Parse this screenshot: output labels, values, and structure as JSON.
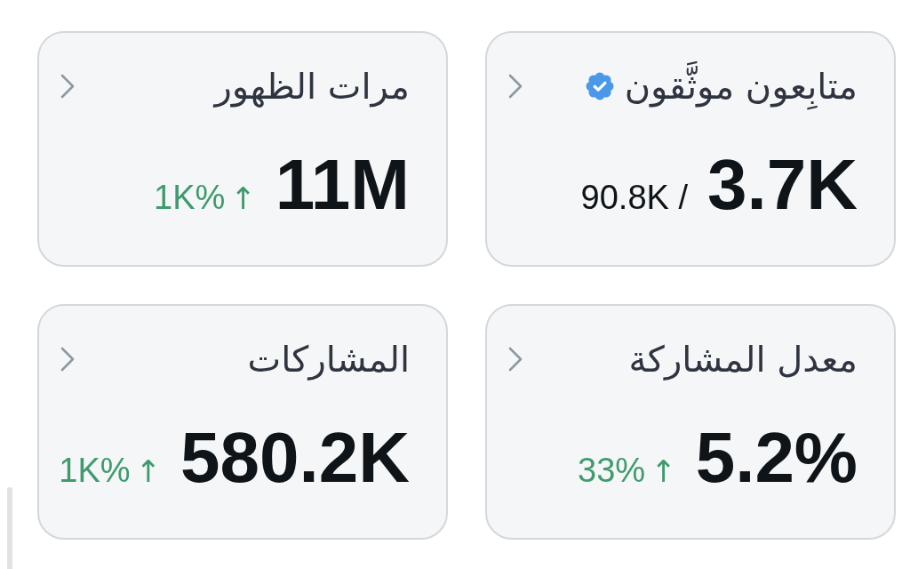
{
  "cards": [
    {
      "title": "متابِعون موثَّقون",
      "verified": true,
      "value": "3.7K",
      "total": "90.8K /"
    },
    {
      "title": "مرات الظهور",
      "verified": false,
      "value": "11M",
      "change": "1K%",
      "arrow": "↑"
    },
    {
      "title": "معدل المشاركة",
      "verified": false,
      "value": "5.2%",
      "change": "33%",
      "arrow": "↑"
    },
    {
      "title": "المشاركات",
      "verified": false,
      "value": "580.2K",
      "change": "1K%",
      "arrow": "↑"
    }
  ]
}
